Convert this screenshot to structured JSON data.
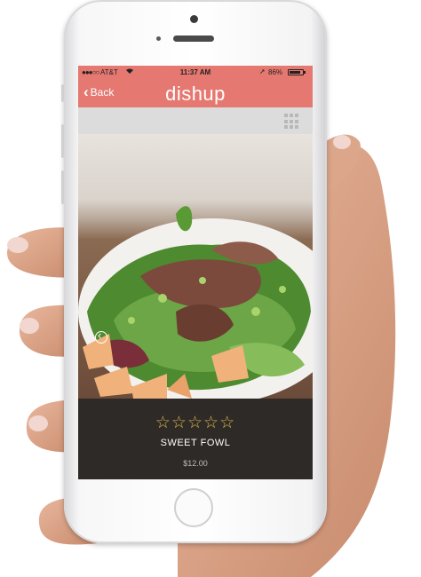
{
  "status": {
    "carrier": "AT&T",
    "time": "11:37 AM",
    "battery": "86%"
  },
  "nav": {
    "back_label": "Back",
    "logo_text": "dishup"
  },
  "dish": {
    "name": "SWEET FOWL",
    "price": "$12.00",
    "rating": 0,
    "max_rating": 5
  },
  "colors": {
    "brand": "#e57870",
    "star": "#d9b44a",
    "info_bg": "#2e2a27"
  }
}
